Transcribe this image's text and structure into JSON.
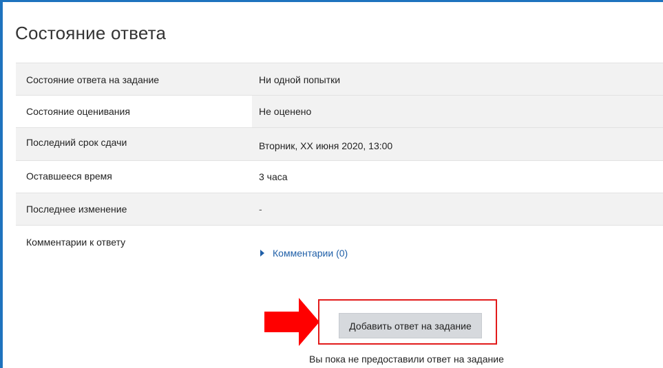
{
  "section": {
    "title": "Состояние ответа"
  },
  "status_table": {
    "rows": [
      {
        "label": "Состояние ответа на задание",
        "value": "Ни одной попытки"
      },
      {
        "label": "Состояние оценивания",
        "value": "Не оценено"
      },
      {
        "label": "Последний срок сдачи",
        "value": "Вторник, XX июня 2020, 13:00"
      },
      {
        "label": "Оставшееся время",
        "value": "3 часа"
      },
      {
        "label": "Последнее изменение",
        "value": "-"
      },
      {
        "label": "Комментарии к ответу",
        "value": ""
      }
    ]
  },
  "comments": {
    "link_label": "Комментарии (0)"
  },
  "actions": {
    "add_submission_label": "Добавить ответ на задание",
    "note": "Вы пока не предоставили ответ на задание"
  },
  "colors": {
    "frame_border": "#1e73be",
    "highlight": "#e21a1a",
    "arrow": "#ff0000",
    "link": "#1f5fa8",
    "row_shade": "#f2f2f2"
  }
}
